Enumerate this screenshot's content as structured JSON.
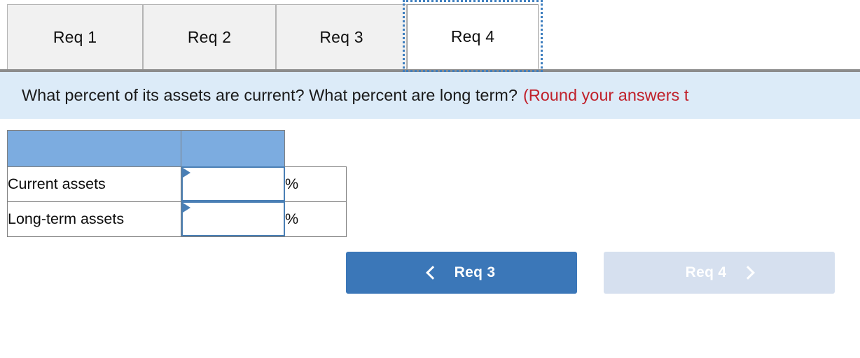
{
  "tabs": [
    {
      "label": "Req 1",
      "active": false
    },
    {
      "label": "Req 2",
      "active": false
    },
    {
      "label": "Req 3",
      "active": false
    },
    {
      "label": "Req 4",
      "active": true
    }
  ],
  "question": {
    "text": "What percent of its assets are current? What percent are long term?",
    "hint": "(Round your answers t"
  },
  "table": {
    "header_label": "",
    "unit_symbol": "%",
    "rows": [
      {
        "label": "Current assets",
        "value": "",
        "unit": "%"
      },
      {
        "label": "Long-term assets",
        "value": "",
        "unit": "%"
      }
    ]
  },
  "navigation": {
    "prev_label": "Req 3",
    "next_label": "Req 4",
    "prev_icon": "chevron-left-icon",
    "next_icon": "chevron-right-icon"
  },
  "colors": {
    "tab_inactive_bg": "#f1f1f1",
    "tab_active_bg": "#ffffff",
    "focus_ring": "#3f7fbf",
    "banner_bg": "#dcebf8",
    "hint_red": "#c0202a",
    "table_header_blue": "#7cace0",
    "input_border_blue": "#4a7fb5",
    "button_active_blue": "#3b77b8",
    "button_disabled_blue": "#d6e0ef"
  }
}
